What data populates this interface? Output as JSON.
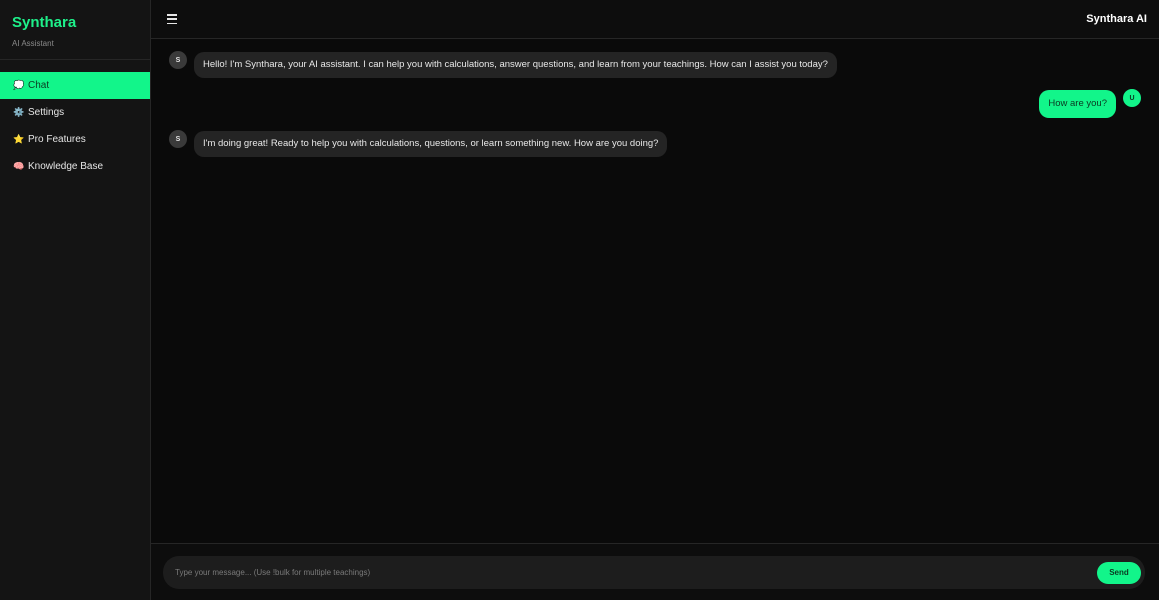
{
  "sidebar": {
    "brand_title": "Synthara",
    "brand_subtitle": "AI Assistant",
    "items": [
      {
        "label": "Chat",
        "icon": "speech-bubble-icon",
        "glyph": "💭",
        "active": true
      },
      {
        "label": "Settings",
        "icon": "gear-icon",
        "glyph": "⚙️",
        "active": false
      },
      {
        "label": "Pro Features",
        "icon": "star-icon",
        "glyph": "⭐",
        "active": false
      },
      {
        "label": "Knowledge Base",
        "icon": "brain-icon",
        "glyph": "🧠",
        "active": false
      }
    ]
  },
  "header": {
    "menu_icon": "hamburger-menu-icon",
    "title": "Synthara AI"
  },
  "messages": [
    {
      "role": "bot",
      "avatar": "S",
      "text": "Hello! I'm Synthara, your AI assistant. I can help you with calculations, answer questions, and learn from your teachings. How can I assist you today?"
    },
    {
      "role": "user",
      "avatar": "U",
      "text": "How are you?"
    },
    {
      "role": "bot",
      "avatar": "S",
      "text": "I'm doing great! Ready to help you with calculations, questions, or learn something new. How are you doing?"
    }
  ],
  "composer": {
    "placeholder": "Type your message... (Use !bulk for multiple teachings)",
    "value": "",
    "send_label": "Send"
  },
  "colors": {
    "accent": "#12f58a",
    "brand": "#1ef08a",
    "background": "#0a0a0a",
    "sidebar": "#141414",
    "bubble_bot": "#242424"
  }
}
